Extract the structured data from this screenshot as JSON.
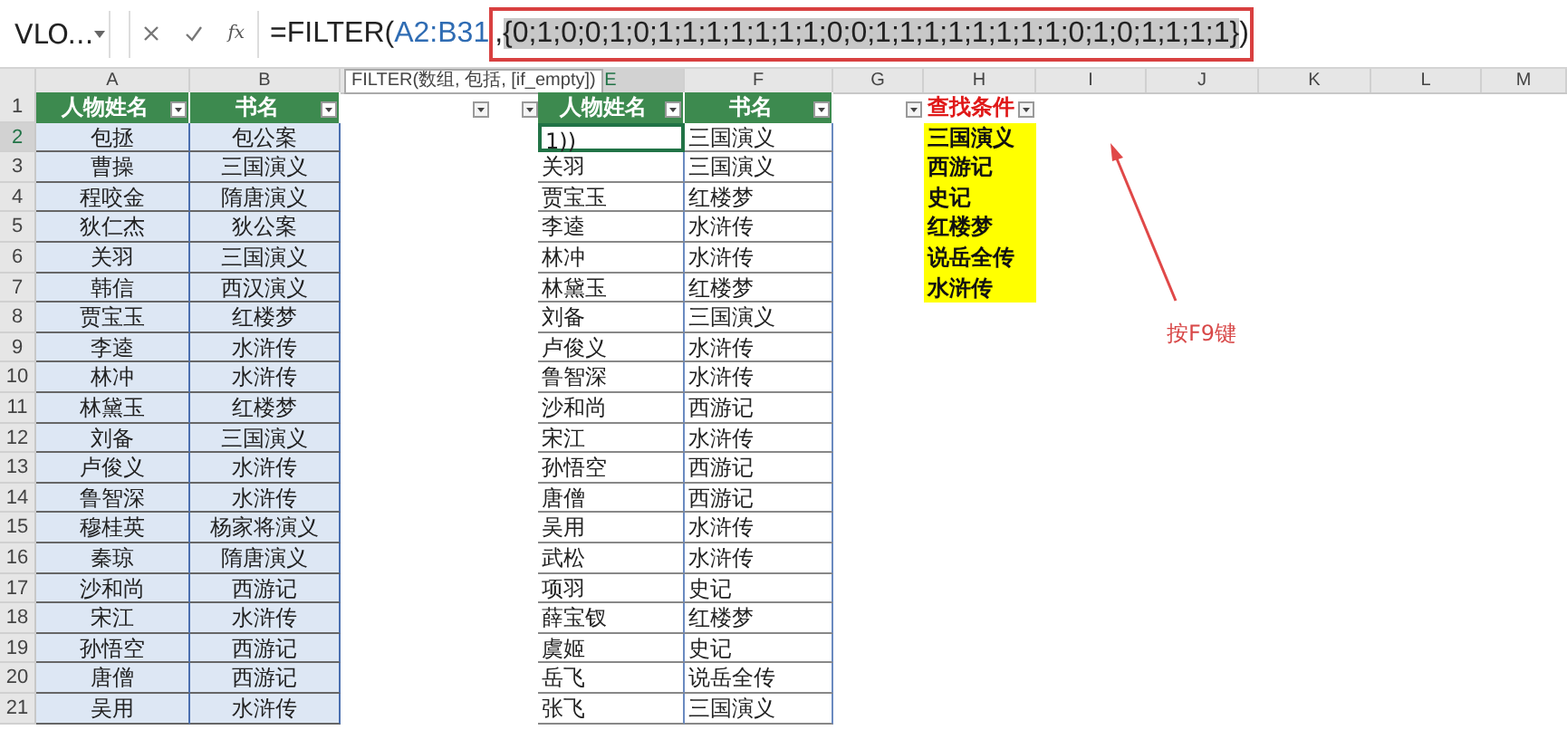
{
  "name_box": "VLO...",
  "formula_bar": {
    "function_label": "fx",
    "parts": [
      {
        "text": "=FILTER(",
        "kind": "plain"
      },
      {
        "text": "A2:B31",
        "kind": "ref"
      }
    ],
    "boxed_parts": [
      {
        "text": ",",
        "kind": "plain"
      },
      {
        "text": "{0;1;0;0;1;0;1;1;1;1;1;1;1;0;0;1;1;1;1;1;1;1;1;0;1;0;1;1;1;1}",
        "kind": "selected"
      },
      {
        "text": ")",
        "kind": "plain"
      }
    ]
  },
  "tooltip": "FILTER(数组, 包括, [if_empty])",
  "column_headers": [
    "A",
    "B",
    "E",
    "F",
    "G",
    "H",
    "I",
    "J",
    "K",
    "L",
    "M"
  ],
  "row_numbers": [
    "1",
    "2",
    "3",
    "4",
    "5",
    "6",
    "7",
    "8",
    "9",
    "10",
    "11",
    "12",
    "13",
    "14",
    "15",
    "16",
    "17",
    "18",
    "19",
    "20",
    "21"
  ],
  "source_table": {
    "columns": [
      "人物姓名",
      "书名"
    ],
    "rows": [
      [
        "包拯",
        "包公案"
      ],
      [
        "曹操",
        "三国演义"
      ],
      [
        "程咬金",
        "隋唐演义"
      ],
      [
        "狄仁杰",
        "狄公案"
      ],
      [
        "关羽",
        "三国演义"
      ],
      [
        "韩信",
        "西汉演义"
      ],
      [
        "贾宝玉",
        "红楼梦"
      ],
      [
        "李逵",
        "水浒传"
      ],
      [
        "林冲",
        "水浒传"
      ],
      [
        "林黛玉",
        "红楼梦"
      ],
      [
        "刘备",
        "三国演义"
      ],
      [
        "卢俊义",
        "水浒传"
      ],
      [
        "鲁智深",
        "水浒传"
      ],
      [
        "穆桂英",
        "杨家将演义"
      ],
      [
        "秦琼",
        "隋唐演义"
      ],
      [
        "沙和尚",
        "西游记"
      ],
      [
        "宋江",
        "水浒传"
      ],
      [
        "孙悟空",
        "西游记"
      ],
      [
        "唐僧",
        "西游记"
      ],
      [
        "吴用",
        "水浒传"
      ]
    ]
  },
  "result_table": {
    "columns": [
      "人物姓名",
      "书名"
    ],
    "rows": [
      [
        "1))",
        "三国演义"
      ],
      [
        "关羽",
        "三国演义"
      ],
      [
        "贾宝玉",
        "红楼梦"
      ],
      [
        "李逵",
        "水浒传"
      ],
      [
        "林冲",
        "水浒传"
      ],
      [
        "林黛玉",
        "红楼梦"
      ],
      [
        "刘备",
        "三国演义"
      ],
      [
        "卢俊义",
        "水浒传"
      ],
      [
        "鲁智深",
        "水浒传"
      ],
      [
        "沙和尚",
        "西游记"
      ],
      [
        "宋江",
        "水浒传"
      ],
      [
        "孙悟空",
        "西游记"
      ],
      [
        "唐僧",
        "西游记"
      ],
      [
        "吴用",
        "水浒传"
      ],
      [
        "武松",
        "水浒传"
      ],
      [
        "项羽",
        "史记"
      ],
      [
        "薛宝钗",
        "红楼梦"
      ],
      [
        "虞姬",
        "史记"
      ],
      [
        "岳飞",
        "说岳全传"
      ],
      [
        "张飞",
        "三国演义"
      ]
    ]
  },
  "criteria": {
    "title": "查找条件",
    "items": [
      "三国演义",
      "西游记",
      "史记",
      "红楼梦",
      "说岳全传",
      "水浒传"
    ]
  },
  "annotation": "按F9键"
}
